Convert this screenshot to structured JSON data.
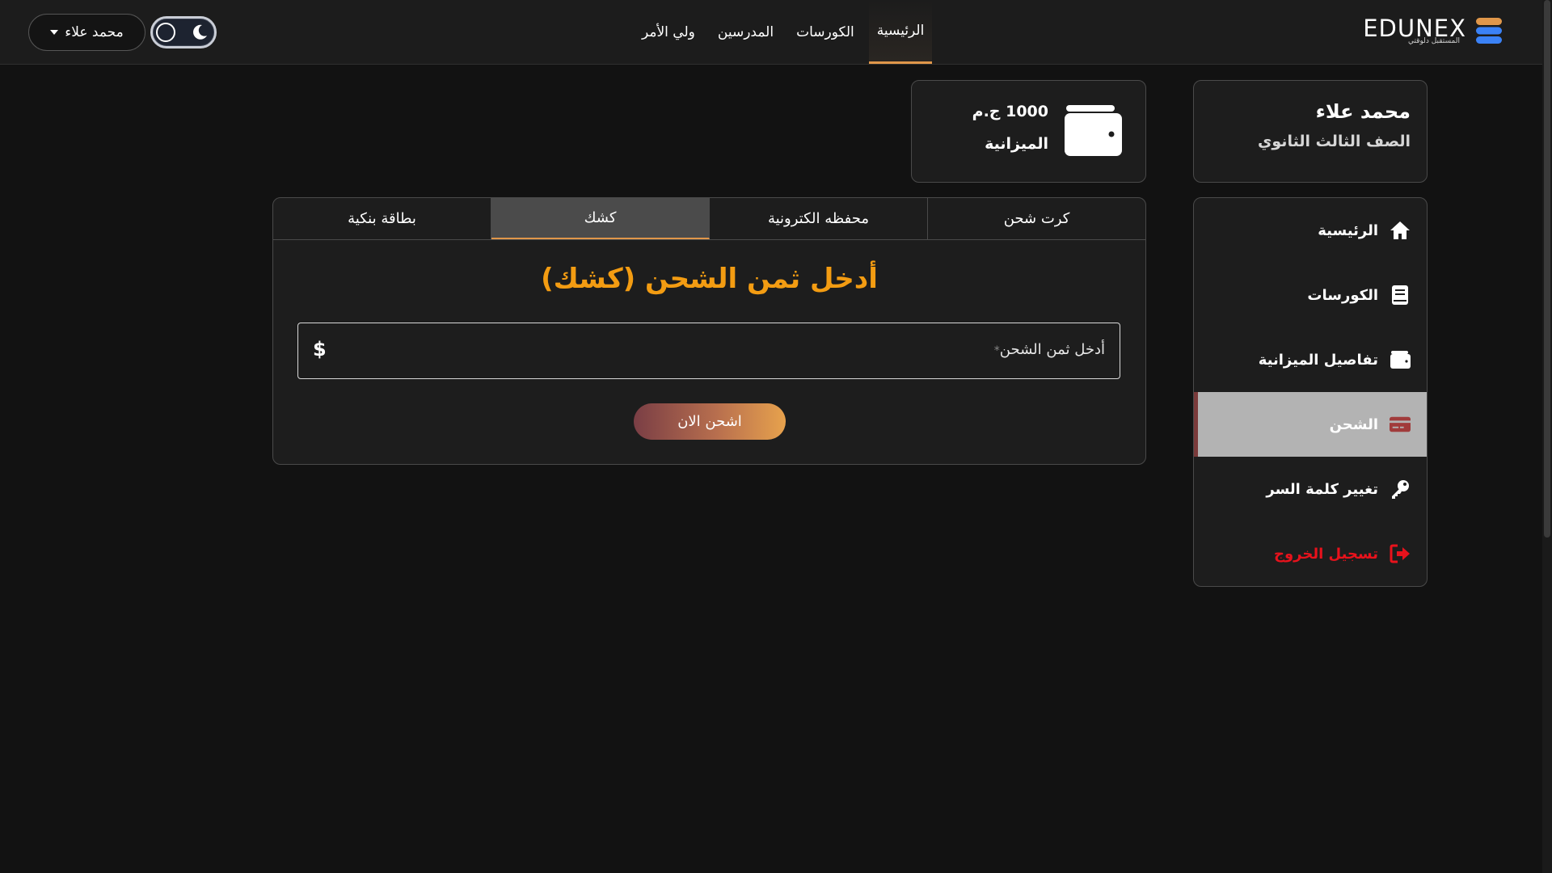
{
  "brand": {
    "name": "EDUNEX",
    "tagline": "المستقبل دلوقتي"
  },
  "nav": {
    "items": [
      {
        "label": "الرئيسية",
        "active": true
      },
      {
        "label": "الكورسات",
        "active": false
      },
      {
        "label": "المدرسين",
        "active": false
      },
      {
        "label": "ولي الأمر",
        "active": false
      }
    ]
  },
  "user_menu": {
    "label": "محمد علاء"
  },
  "theme_toggle": {
    "mode": "dark",
    "icon": "moon-icon"
  },
  "profile": {
    "name": "محمد علاء",
    "grade": "الصف الثالث الثانوي"
  },
  "balance": {
    "amount": "1000 ج.م",
    "label": "الميزانية"
  },
  "sidebar": {
    "items": [
      {
        "label": "الرئيسية",
        "icon": "home-icon"
      },
      {
        "label": "الكورسات",
        "icon": "book-icon"
      },
      {
        "label": "تفاصيل الميزانية",
        "icon": "wallet-icon"
      },
      {
        "label": "الشحن",
        "icon": "credit-card-icon",
        "active": true
      },
      {
        "label": "تغيير كلمة السر",
        "icon": "key-icon"
      },
      {
        "label": "تسجيل الخروج",
        "icon": "logout-icon"
      }
    ]
  },
  "charge": {
    "tabs": [
      {
        "label": "بطاقة بنكية"
      },
      {
        "label": "كشك",
        "active": true
      },
      {
        "label": "محفظه الكترونية"
      },
      {
        "label": "كرت شحن"
      }
    ],
    "title": "أدخل ثمن الشحن (كشك)",
    "amount_placeholder": "أدخل ثمن الشحن",
    "required_mark": "*",
    "currency_symbol": "$",
    "submit_label": "اشحن الان"
  },
  "colors": {
    "accent": "#e0974a",
    "title": "#f39c12",
    "logout": "#e8121c",
    "background": "#121212",
    "card": "#1d1d1d"
  }
}
